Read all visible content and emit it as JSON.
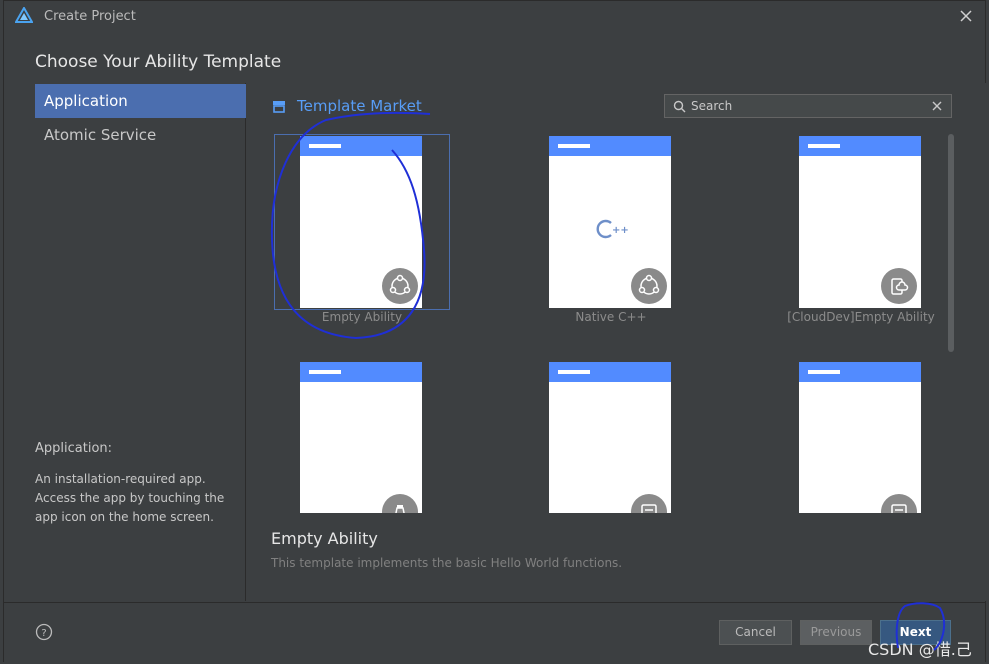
{
  "window": {
    "title": "Create Project"
  },
  "header": {
    "title": "Choose Your Ability Template"
  },
  "sidebar": {
    "items": [
      {
        "label": "Application",
        "selected": true
      },
      {
        "label": "Atomic Service",
        "selected": false
      }
    ],
    "description": {
      "heading": "Application:",
      "body": "An installation-required app. Access the app by touching the app icon on the home screen."
    }
  },
  "content": {
    "market_label": "Template Market",
    "search": {
      "placeholder": "Search",
      "value": ""
    },
    "templates": [
      {
        "label": "Empty Ability",
        "icon": "ability-icon",
        "selected": true
      },
      {
        "label": "Native C++",
        "icon": "ability-icon",
        "selected": false
      },
      {
        "label": "[CloudDev]Empty Ability",
        "icon": "cloud-device-icon",
        "selected": false
      },
      {
        "label": "",
        "icon": "service-icon",
        "selected": false
      },
      {
        "label": "",
        "icon": "form-icon",
        "selected": false
      },
      {
        "label": "",
        "icon": "form-icon",
        "selected": false
      }
    ],
    "selected_template": {
      "title": "Empty Ability",
      "description": "This template implements the basic Hello World functions."
    }
  },
  "footer": {
    "cancel_label": "Cancel",
    "previous_label": "Previous",
    "next_label": "Next"
  },
  "watermark": "CSDN @惜.己",
  "colors": {
    "accent": "#4b6eaf",
    "link": "#589df6",
    "phone_bar": "#528bff",
    "annotation": "#1f2fd6"
  }
}
